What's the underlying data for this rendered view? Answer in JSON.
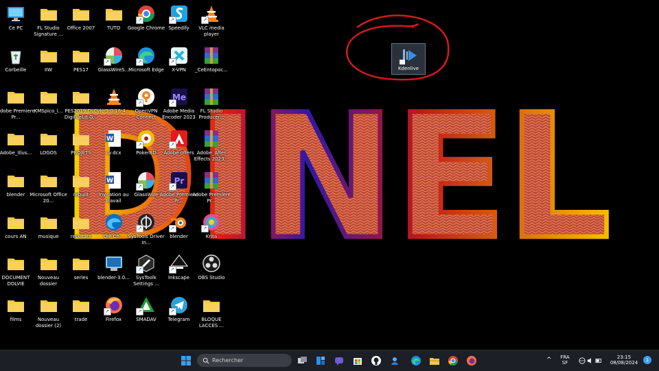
{
  "desktop": {
    "icons": [
      {
        "label": "Ce PC",
        "icon": "monitor-icon",
        "col": 0,
        "row": 0,
        "shortcut": false
      },
      {
        "label": "Corbeille",
        "icon": "recycle-bin-icon",
        "col": 0,
        "row": 1,
        "shortcut": false
      },
      {
        "label": "Adobe Premiere Pr...",
        "icon": "folder-icon",
        "col": 0,
        "row": 2,
        "shortcut": false
      },
      {
        "label": "Adobe_Illus...",
        "icon": "folder-icon",
        "col": 0,
        "row": 3,
        "shortcut": false
      },
      {
        "label": "blender",
        "icon": "folder-icon",
        "col": 0,
        "row": 4,
        "shortcut": false
      },
      {
        "label": "cours AN",
        "icon": "folder-icon",
        "col": 0,
        "row": 5,
        "shortcut": false
      },
      {
        "label": "DOCUMENT DOLVIE",
        "icon": "folder-icon",
        "col": 0,
        "row": 6,
        "shortcut": false
      },
      {
        "label": "films",
        "icon": "folder-icon",
        "col": 0,
        "row": 7,
        "shortcut": false
      },
      {
        "label": "FL Studio Signature ...",
        "icon": "folder-icon",
        "col": 1,
        "row": 0,
        "shortcut": false
      },
      {
        "label": "IIW",
        "icon": "folder-icon",
        "col": 1,
        "row": 1,
        "shortcut": false
      },
      {
        "label": "KMSpico_l...",
        "icon": "folder-icon",
        "col": 1,
        "row": 2,
        "shortcut": false
      },
      {
        "label": "LOGOS",
        "icon": "folder-icon",
        "col": 1,
        "row": 3,
        "shortcut": false
      },
      {
        "label": "Microsoft Office 20...",
        "icon": "folder-icon",
        "col": 1,
        "row": 4,
        "shortcut": false
      },
      {
        "label": "musique",
        "icon": "folder-icon",
        "col": 1,
        "row": 5,
        "shortcut": false
      },
      {
        "label": "Nouveau dossier",
        "icon": "folder-icon",
        "col": 1,
        "row": 6,
        "shortcut": false
      },
      {
        "label": "Nouveau dossier (2)",
        "icon": "folder-icon",
        "col": 1,
        "row": 7,
        "shortcut": false
      },
      {
        "label": "Office 2007",
        "icon": "folder-icon",
        "col": 2,
        "row": 0,
        "shortcut": false
      },
      {
        "label": "PES17",
        "icon": "folder-icon",
        "col": 2,
        "row": 1,
        "shortcut": false
      },
      {
        "label": "PES2019 DLC DigiFileLit G...",
        "icon": "folder-icon",
        "col": 2,
        "row": 2,
        "shortcut": false
      },
      {
        "label": "PROJETS",
        "icon": "folder-icon",
        "col": 2,
        "row": 3,
        "shortcut": false
      },
      {
        "label": "rebuilt",
        "icon": "folder-icon",
        "col": 2,
        "row": 4,
        "shortcut": false
      },
      {
        "label": "resultats",
        "icon": "folder-icon",
        "col": 2,
        "row": 5,
        "shortcut": false
      },
      {
        "label": "series",
        "icon": "folder-icon",
        "col": 2,
        "row": 6,
        "shortcut": false
      },
      {
        "label": "trade",
        "icon": "folder-icon",
        "col": 2,
        "row": 7,
        "shortcut": false
      },
      {
        "label": "TUTO",
        "icon": "folder-icon",
        "col": 3,
        "row": 0,
        "shortcut": false
      },
      {
        "label": "GlassWireS...",
        "icon": "glasswire-icon",
        "col": 3,
        "row": 1,
        "shortcut": true
      },
      {
        "label": "vlc-3.0.18-4...",
        "icon": "vlc-icon",
        "col": 3,
        "row": 2,
        "shortcut": false
      },
      {
        "label": "cv.dcx",
        "icon": "word-doc-icon",
        "col": 3,
        "row": 3,
        "shortcut": false
      },
      {
        "label": "Invitation au travail",
        "icon": "word-doc-icon",
        "col": 3,
        "row": 4,
        "shortcut": false
      },
      {
        "label": "QIP Ch...",
        "icon": "edge-alt-icon",
        "col": 3,
        "row": 5,
        "shortcut": false
      },
      {
        "label": "blender-3.0...",
        "icon": "installer-icon",
        "col": 3,
        "row": 6,
        "shortcut": false
      },
      {
        "label": "Firefox",
        "icon": "firefox-icon",
        "col": 3,
        "row": 7,
        "shortcut": true
      },
      {
        "label": "Google Chrome",
        "icon": "chrome-icon",
        "col": 4,
        "row": 0,
        "shortcut": true
      },
      {
        "label": "Microsoft Edge",
        "icon": "edge-icon",
        "col": 4,
        "row": 1,
        "shortcut": true
      },
      {
        "label": "OpenVPN Connect",
        "icon": "openvpn-icon",
        "col": 4,
        "row": 2,
        "shortcut": true
      },
      {
        "label": "PokerBD",
        "icon": "poker-icon",
        "col": 4,
        "row": 3,
        "shortcut": true
      },
      {
        "label": "GlassWire",
        "icon": "glasswire-icon",
        "col": 4,
        "row": 4,
        "shortcut": true
      },
      {
        "label": "SysTools Driver In...",
        "icon": "systools-icon",
        "col": 4,
        "row": 5,
        "shortcut": true
      },
      {
        "label": "SysToolk Settings ...",
        "icon": "tools-icon",
        "col": 4,
        "row": 6,
        "shortcut": true
      },
      {
        "label": "SMADAV",
        "icon": "smadav-icon",
        "col": 4,
        "row": 7,
        "shortcut": true
      },
      {
        "label": "Speedify",
        "icon": "speedify-icon",
        "col": 5,
        "row": 0,
        "shortcut": true
      },
      {
        "label": "X-VPN",
        "icon": "xvpn-icon",
        "col": 5,
        "row": 1,
        "shortcut": true
      },
      {
        "label": "Adobe Media Encoder 2023",
        "icon": "media-encoder-icon",
        "col": 5,
        "row": 2,
        "shortcut": true
      },
      {
        "label": "Adobe offers",
        "icon": "adobe-icon",
        "col": 5,
        "row": 3,
        "shortcut": true
      },
      {
        "label": "Adobe Premiere Pr...",
        "icon": "premiere-icon",
        "col": 5,
        "row": 4,
        "shortcut": true
      },
      {
        "label": "blender",
        "icon": "blender-icon",
        "col": 5,
        "row": 5,
        "shortcut": true
      },
      {
        "label": "Inkscape",
        "icon": "inkscape-icon",
        "col": 5,
        "row": 6,
        "shortcut": true
      },
      {
        "label": "Telegram",
        "icon": "telegram-icon",
        "col": 5,
        "row": 7,
        "shortcut": true
      },
      {
        "label": "VLC media player",
        "icon": "vlc-icon",
        "col": 6,
        "row": 0,
        "shortcut": true
      },
      {
        "label": "_CeEntopoc...",
        "icon": "winrar-icon",
        "col": 6,
        "row": 1,
        "shortcut": false
      },
      {
        "label": "FL Studio Producer...",
        "icon": "winrar-icon",
        "col": 6,
        "row": 2,
        "shortcut": false
      },
      {
        "label": "Adobe_After Effects 2023...",
        "icon": "winrar-icon",
        "col": 6,
        "row": 3,
        "shortcut": false
      },
      {
        "label": "Adobe Premiere Pr...",
        "icon": "winrar-icon",
        "col": 6,
        "row": 4,
        "shortcut": false
      },
      {
        "label": "Krita",
        "icon": "krita-icon",
        "col": 6,
        "row": 5,
        "shortcut": true
      },
      {
        "label": "OBS Studio",
        "icon": "obs-icon",
        "col": 6,
        "row": 6,
        "shortcut": false
      },
      {
        "label": "BLOQUE LACCES ...",
        "icon": "folder-icon",
        "col": 6,
        "row": 7,
        "shortcut": false
      }
    ],
    "kdenlive": {
      "label": "Kdenlive",
      "icon": "kdenlive-icon"
    },
    "wallpaper_text": "DINEL"
  },
  "taskbar": {
    "start_icon": "windows-start-icon",
    "search_placeholder": "Rechercher",
    "pinned": [
      "task-view-icon",
      "widgets-icon",
      "teams-chat-icon",
      "store-icon",
      "github-icon",
      "copilot-icon",
      "edge-icon",
      "file-explorer-icon",
      "chrome-icon",
      "firefox-icon"
    ],
    "tray": {
      "chevron": "^",
      "lang_line1": "FRA",
      "lang_line2": "SF",
      "time": "23:15",
      "date": "08/08/2024",
      "notification_count": "1"
    }
  },
  "colors": {
    "folder": "#f2c744",
    "taskbar_bg": "#1c1f26",
    "kdenlive_circle": "#d51a1a"
  }
}
